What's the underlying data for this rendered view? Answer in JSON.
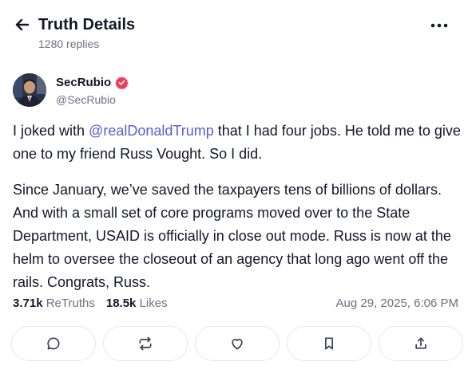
{
  "header": {
    "title": "Truth Details",
    "replies": "1280 replies"
  },
  "post": {
    "display_name": "SecRubio",
    "handle": "@SecRubio",
    "paragraph1": {
      "prefix": "I joked with ",
      "mention": "@realDonaldTrump",
      "suffix": " that I had four jobs. He told me to give one to my friend Russ Vought. So I did."
    },
    "paragraph2": "Since January, we’ve saved the taxpayers tens of billions of dollars. And with a small set of core programs moved over to the State Department, USAID is officially in close out mode. Russ is now at the helm to oversee the closeout of an agency that long ago went off the rails. Congrats, Russ.",
    "stats": {
      "retruths_count": "3.71k",
      "retruths_label": "ReTruths",
      "likes_count": "18.5k",
      "likes_label": "Likes"
    },
    "timestamp": "Aug 29, 2025, 6:06 PM"
  },
  "icons": {
    "back": "arrow-left-icon",
    "more": "more-horizontal-icon",
    "verified": "verified-badge-icon",
    "reply": "comment-icon",
    "retruth": "repost-icon",
    "like": "heart-icon",
    "bookmark": "bookmark-icon",
    "share": "share-icon"
  },
  "colors": {
    "mention": "#5b5bd6",
    "verified": "#ef3b5a",
    "muted": "#6b7280"
  }
}
